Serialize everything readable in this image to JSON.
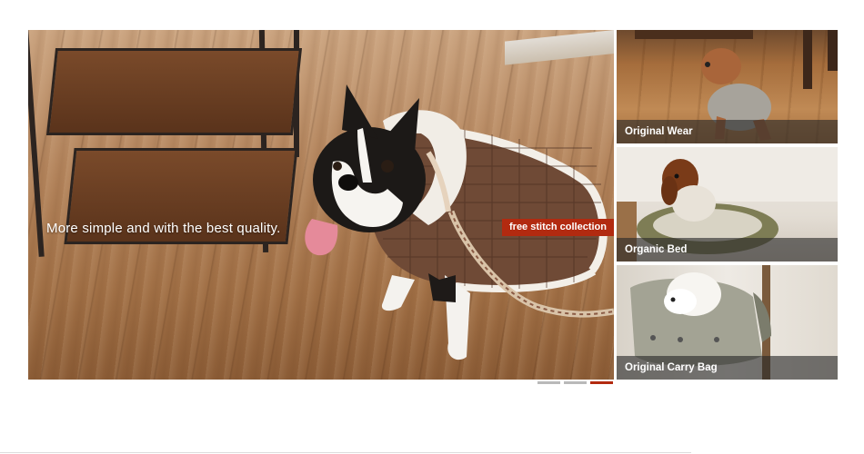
{
  "hero": {
    "tagline": "More simple and with the best quality.",
    "badge": "free stitch collection"
  },
  "thumbnails": [
    {
      "caption": "Original Wear"
    },
    {
      "caption": "Organic Bed"
    },
    {
      "caption": "Original Carry Bag"
    }
  ],
  "pager": {
    "count": 3,
    "active_index": 3
  },
  "colors": {
    "accent": "#b22a10",
    "caption_overlay": "#282828",
    "pager_inactive": "#b9b9b9"
  }
}
